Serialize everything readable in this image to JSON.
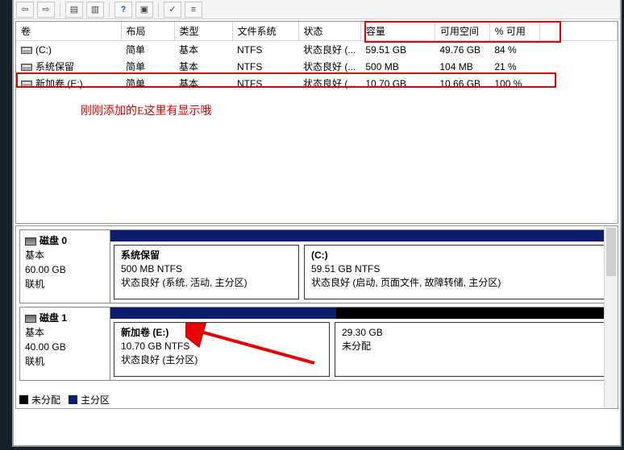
{
  "columns": {
    "volume": "卷",
    "layout": "布局",
    "type": "类型",
    "filesystem": "文件系统",
    "status": "状态",
    "capacity": "容量",
    "free": "可用空间",
    "pct": "% 可用"
  },
  "volumes": [
    {
      "name": "(C:)",
      "layout": "简单",
      "type": "基本",
      "fs": "NTFS",
      "status": "状态良好 (...",
      "capacity": "59.51 GB",
      "free": "49.76 GB",
      "pct": "84 %"
    },
    {
      "name": "系统保留",
      "layout": "简单",
      "type": "基本",
      "fs": "NTFS",
      "status": "状态良好 (...",
      "capacity": "500 MB",
      "free": "104 MB",
      "pct": "21 %"
    },
    {
      "name": "新加卷 (E:)",
      "layout": "简单",
      "type": "基本",
      "fs": "NTFS",
      "status": "状态良好 (...",
      "capacity": "10.70 GB",
      "free": "10.66 GB",
      "pct": "100 %"
    }
  ],
  "annotation_text": "刚刚添加的E这里有显示哦",
  "disks": [
    {
      "title": "磁盘 0",
      "kind": "基本",
      "size": "60.00 GB",
      "state": "联机",
      "header_color": "blue",
      "partitions": [
        {
          "title": "系统保留",
          "size": "500 MB NTFS",
          "status": "状态良好 (系统, 活动, 主分区)",
          "bar": "blue"
        },
        {
          "title": "(C:)",
          "size": "59.51 GB NTFS",
          "status": "状态良好 (启动, 页面文件, 故障转储, 主分区)",
          "bar": "blue"
        }
      ]
    },
    {
      "title": "磁盘 1",
      "kind": "基本",
      "size": "40.00 GB",
      "state": "联机",
      "header_color": "split",
      "partitions": [
        {
          "title": "新加卷  (E:)",
          "size": "10.70 GB NTFS",
          "status": "状态良好 (主分区)",
          "bar": "blue"
        },
        {
          "title": "",
          "size": "29.30 GB",
          "status": "未分配",
          "bar": "black"
        }
      ]
    }
  ],
  "legend": {
    "unallocated": "未分配",
    "primary": "主分区"
  }
}
